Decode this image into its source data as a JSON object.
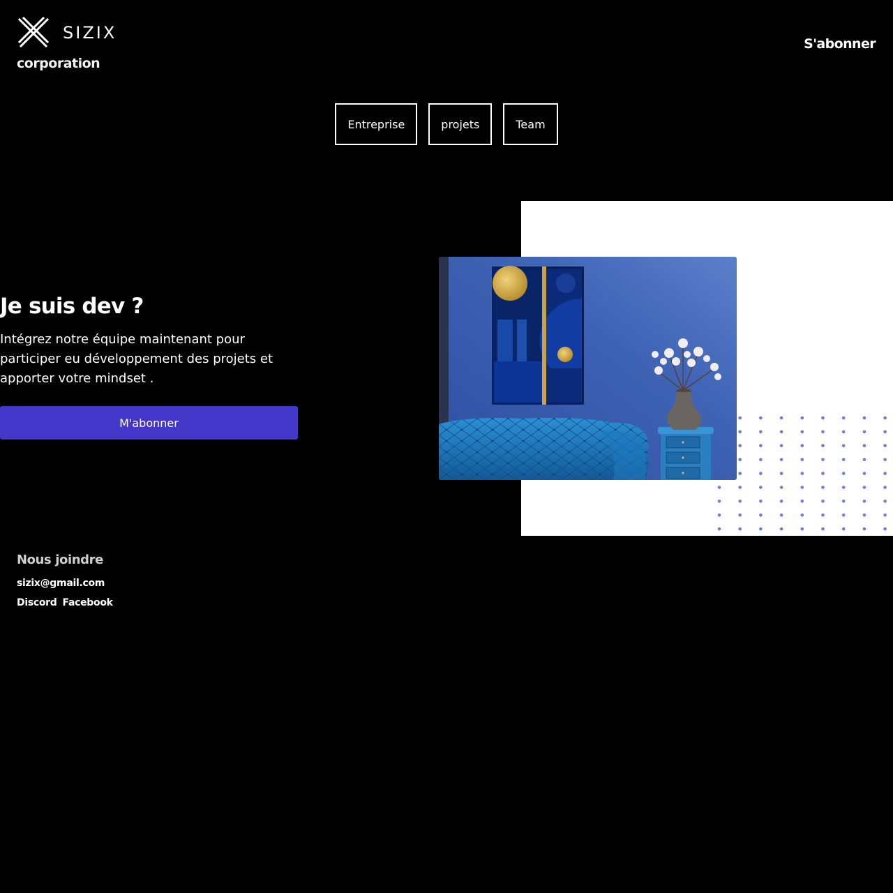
{
  "brand": {
    "logo_icon": "sizix-x-logo",
    "name": "SIZIX",
    "tagline": "corporation"
  },
  "header": {
    "subscribe_link": "S'abonner"
  },
  "nav": {
    "items": [
      {
        "label": "Entreprise"
      },
      {
        "label": "projets"
      },
      {
        "label": "Team"
      }
    ]
  },
  "hero": {
    "title": "Je suis dev ?",
    "text": "Intégrez notre équipe maintenant pour participer eu développement des projets et apporter votre mindset .",
    "cta_label": "M'abonner",
    "image": "living-room-blue-sofa-photo"
  },
  "footer": {
    "title": "Nous joindre",
    "email": "sizix@gmail.com",
    "links": [
      {
        "label": "Discord"
      },
      {
        "label": "Facebook"
      }
    ]
  },
  "colors": {
    "background": "#000000",
    "accent": "#4338ca",
    "dots": "#6b7ce8",
    "panel": "#ffffff"
  }
}
